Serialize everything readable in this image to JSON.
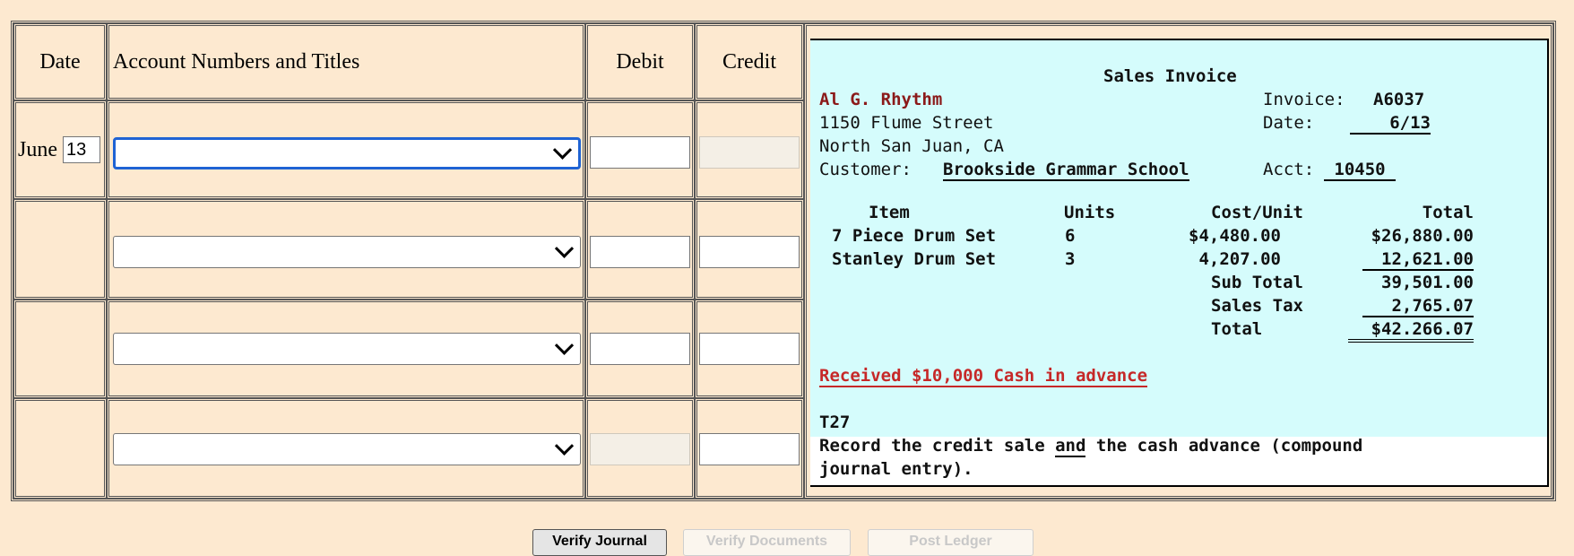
{
  "journal": {
    "headers": {
      "date": "Date",
      "account": "Account Numbers and Titles",
      "debit": "Debit",
      "credit": "Credit"
    },
    "rows": [
      {
        "month": "June",
        "day": "13"
      },
      {
        "month": "",
        "day": ""
      },
      {
        "month": "",
        "day": ""
      },
      {
        "month": "",
        "day": ""
      }
    ]
  },
  "invoice": {
    "title": "Sales Invoice",
    "company": "Al G. Rhythm",
    "street": "1150 Flume Street",
    "city": "North San Juan, CA",
    "invoice_label": "Invoice:",
    "invoice_no": "A6037",
    "date_label": "Date:",
    "date": "6/13",
    "customer_label": "Customer:",
    "customer": "Brookside Grammar School",
    "acct_label": "Acct:",
    "acct": "10450",
    "columns": {
      "item": "Item",
      "units": "Units",
      "cost": "Cost/Unit",
      "total": "Total"
    },
    "lines": [
      {
        "item": "7 Piece Drum Set",
        "units": "6",
        "cost": "$4,480.00",
        "total": "$26,880.00"
      },
      {
        "item": "Stanley Drum Set",
        "units": "3",
        "cost": "4,207.00",
        "total": "12,621.00"
      }
    ],
    "subtotal_label": "Sub Total",
    "subtotal": "39,501.00",
    "tax_label": "Sales Tax",
    "tax": "2,765.07",
    "total_label": "Total",
    "total": "$42.266.07",
    "note": "Received $10,000 Cash in advance",
    "code": "T27",
    "instruction_1": "Record the credit sale ",
    "instruction_and": "and",
    "instruction_2": " the cash advance (compound",
    "instruction_3": "journal entry)."
  },
  "buttons": {
    "verify_journal": "Verify Journal",
    "verify_documents": "Verify Documents",
    "post_ledger": "Post Ledger"
  }
}
